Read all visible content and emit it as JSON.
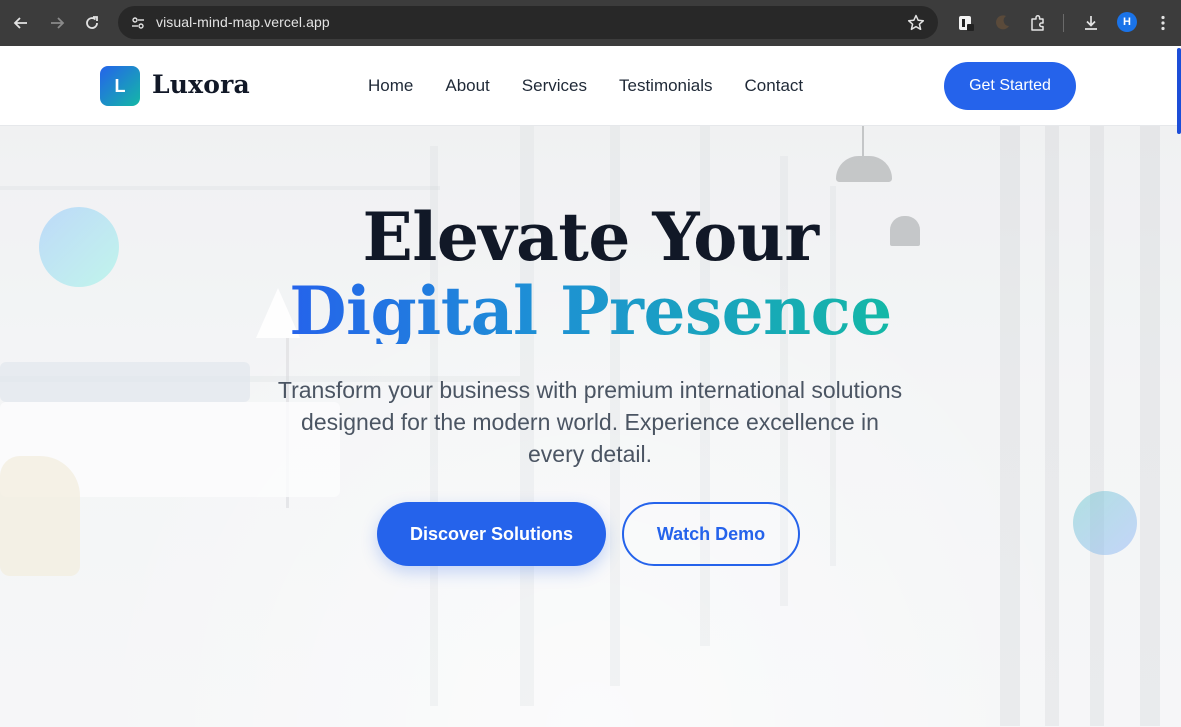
{
  "browser": {
    "url": "visual-mind-map.vercel.app",
    "profile_initial": "H",
    "icons": [
      "back-icon",
      "forward-icon",
      "reload-icon",
      "site-info-icon",
      "bookmark-star-icon",
      "extension-icon",
      "moon-extension-icon",
      "puzzle-icon",
      "download-icon",
      "more-menu-icon"
    ]
  },
  "header": {
    "logo_letter": "L",
    "brand": "Luxora",
    "nav": [
      "Home",
      "About",
      "Services",
      "Testimonials",
      "Contact"
    ],
    "cta": "Get Started"
  },
  "hero": {
    "title_line1": "Elevate Your",
    "title_line2": "Digital Presence",
    "subtitle": "Transform your business with premium international solutions designed for the modern world. Experience excellence in every detail.",
    "primary_button": "Discover Solutions",
    "secondary_button": "Watch Demo"
  },
  "colors": {
    "primary": "#2563eb",
    "accent": "#14b8a6",
    "text_dark": "#111827",
    "text_muted": "#4b5563"
  }
}
